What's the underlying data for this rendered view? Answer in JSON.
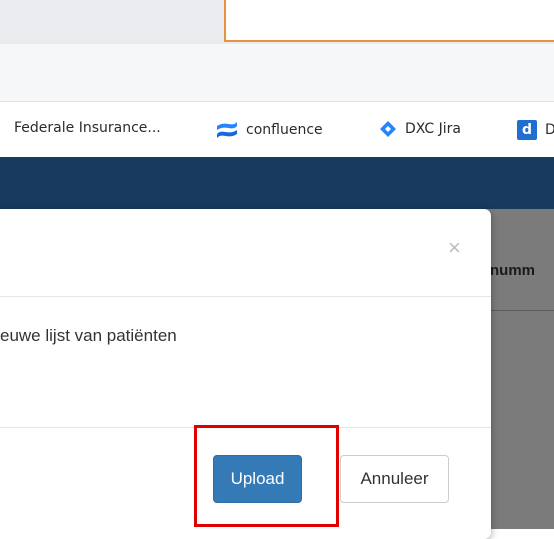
{
  "bookmarks": [
    {
      "label": "Federale Insurance...",
      "icon": "none"
    },
    {
      "label": "confluence",
      "icon": "confluence-icon"
    },
    {
      "label": "DXC Jira",
      "icon": "jira-diamond-icon"
    },
    {
      "label": "D",
      "icon": "d-square-icon",
      "icon_text": "d"
    }
  ],
  "table": {
    "partial_header": "numm"
  },
  "modal": {
    "close_symbol": "×",
    "body_text": "euwe lijst van patiënten",
    "upload_label": "Upload",
    "cancel_label": "Annuleer"
  },
  "colors": {
    "header_band": "#173a5e",
    "primary_button": "#337ab7",
    "highlight": "#e00000",
    "outline_box": "#e8913a"
  }
}
